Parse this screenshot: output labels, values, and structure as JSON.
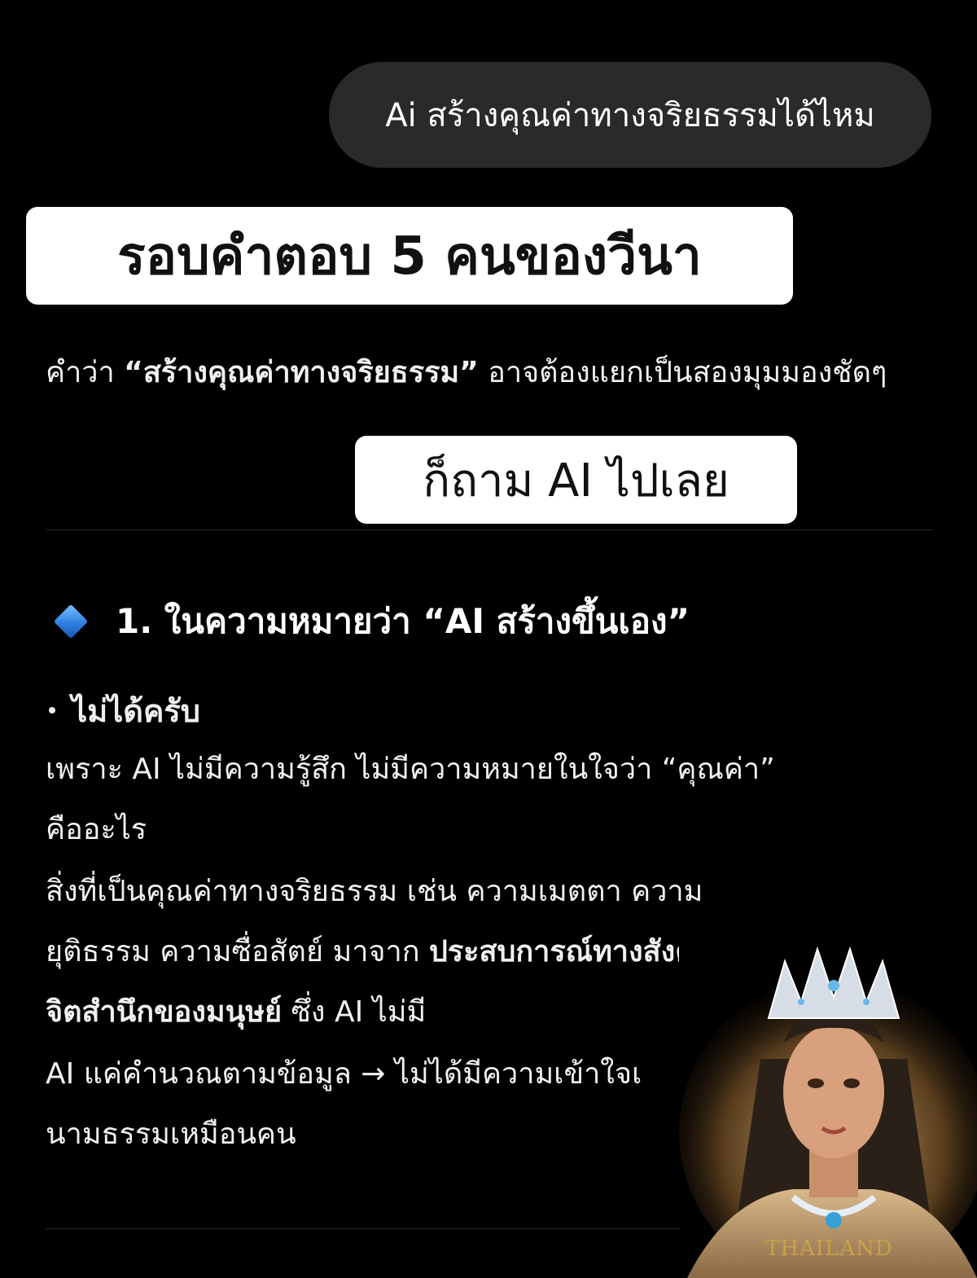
{
  "user_message": "Ai สร้างคุณค่าทางจริยธรรมได้ไหม",
  "banners": {
    "title": "รอบคำตอบ 5 คนของวีนา",
    "subtitle": "ก็ถาม AI ไปเลย"
  },
  "intro": {
    "before": "คำว่า ",
    "bold": "“สร้างคุณค่าทางจริยธรรม”",
    "after": " อาจต้องแยกเป็นสองมุมมองชัดๆ"
  },
  "section": {
    "icon": "blue-diamond-icon",
    "heading": "1. ในความหมายว่า “AI สร้างขึ้นเอง”",
    "bullet": "ไม่ได้ครับ",
    "lines": {
      "l1": "เพราะ AI ไม่มีความรู้สึก ไม่มีความหมายในใจว่า “คุณค่า”",
      "l1b": "คืออะไร",
      "l2": "สิ่งที่เป็นคุณค่าทางจริยธรรม เช่น ความเมตตา ความ",
      "l3_plain": "ยุติธรรม ความซื่อสัตย์ มาจาก ",
      "l3_bold": "ประสบการณ์ทางสังคมและ",
      "l4_bold": "จิตสำนึกของมนุษย์",
      "l4_plain": " ซึ่ง AI ไม่มี",
      "l5": "AI แค่คำนวณตามข้อมูล → ไม่ได้มีความเข้าใจเ",
      "l6": "นามธรรมเหมือนคน"
    }
  },
  "watermark": "THAILAND"
}
